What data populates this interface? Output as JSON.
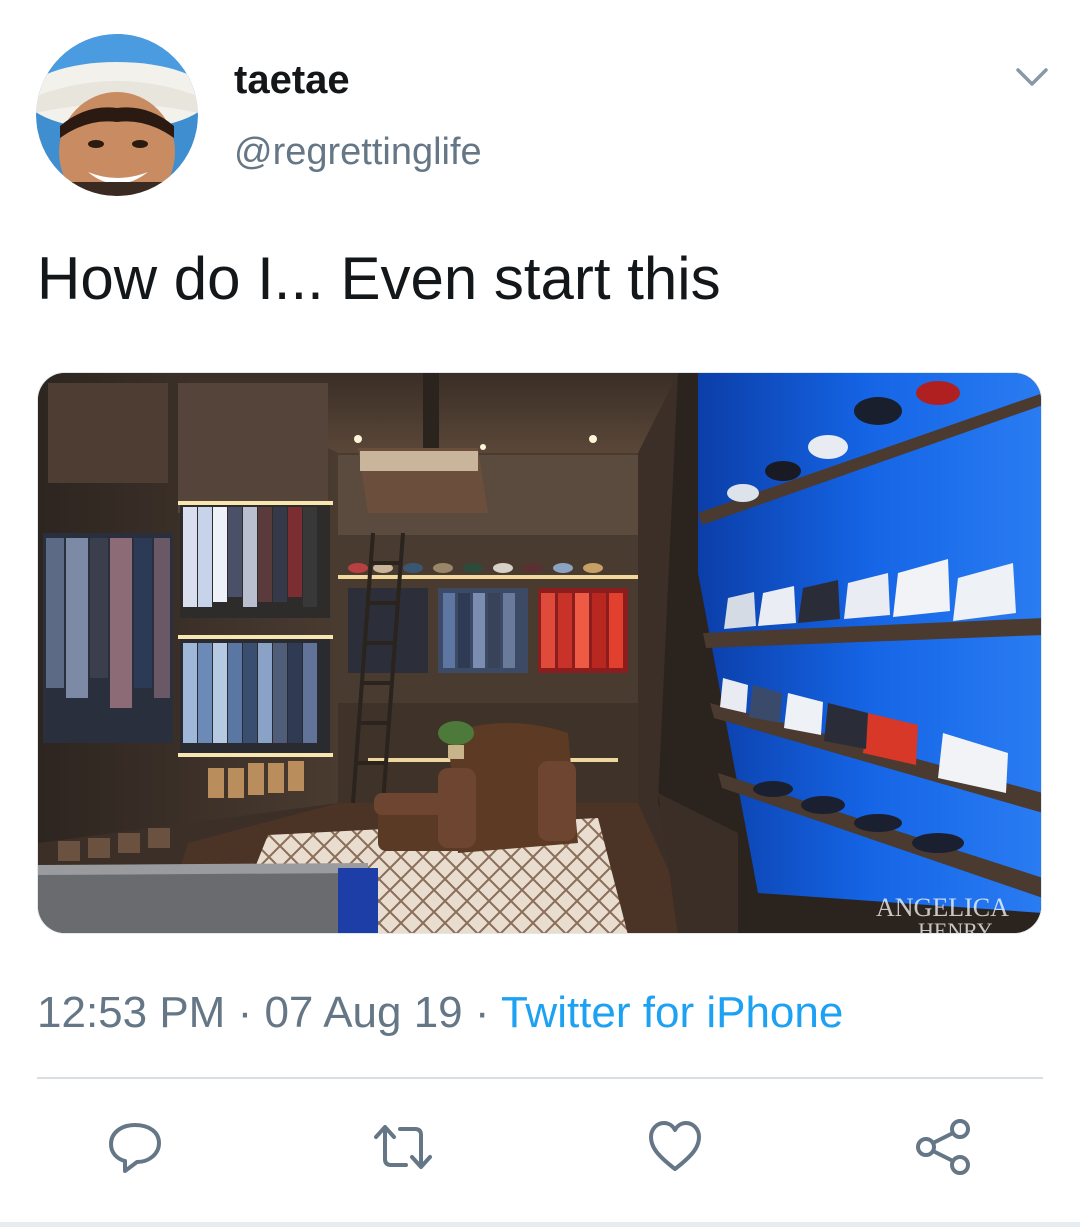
{
  "tweet": {
    "author": {
      "display_name": "taetae",
      "handle": "@regrettinglife"
    },
    "text": "How do I... Even start this",
    "media": {
      "watermark_line1": "ANGELICA",
      "watermark_line2": "HENRY"
    },
    "timestamp": {
      "time": "12:53 PM",
      "separator1": " · ",
      "date": "07 Aug 19",
      "separator2": " · ",
      "source": "Twitter for iPhone"
    }
  },
  "actions": {
    "icons": [
      "reply-icon",
      "retweet-icon",
      "like-icon",
      "share-icon"
    ]
  },
  "colors": {
    "text_primary": "#14171a",
    "text_secondary": "#657786",
    "link_blue": "#1da1f2",
    "action_icon": "#657786",
    "divider": "#d8dee3"
  }
}
